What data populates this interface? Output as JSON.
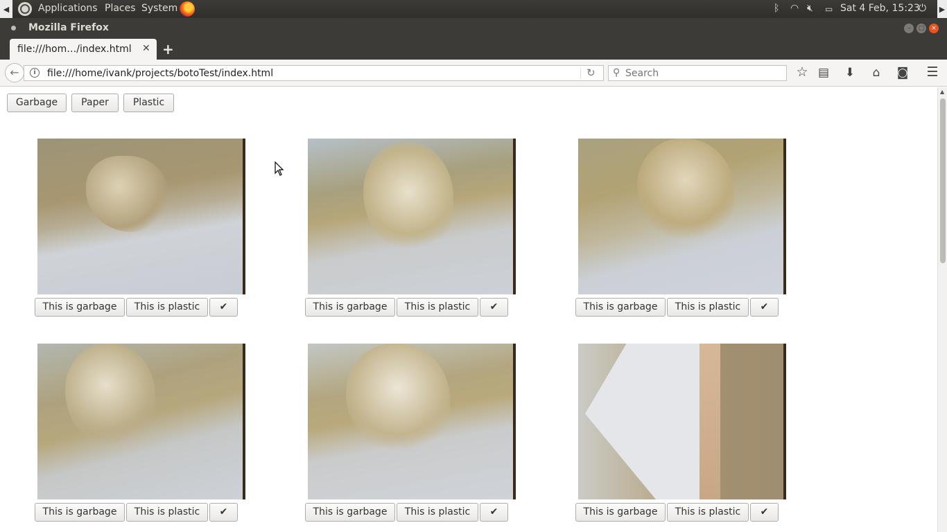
{
  "system_panel": {
    "menus": [
      "Applications",
      "Places",
      "System"
    ],
    "datetime": "Sat  4 Feb, 15:23"
  },
  "window": {
    "title": "Mozilla Firefox"
  },
  "tab": {
    "label": "file:///hom…/index.html"
  },
  "navbar": {
    "url": "file:///home/ivank/projects/botoTest/index.html",
    "search_placeholder": "Search"
  },
  "category_buttons": [
    "Garbage",
    "Paper",
    "Plastic"
  ],
  "item_buttons": {
    "garbage": "This is garbage",
    "plastic": "This is plastic",
    "confirm": "✔"
  },
  "icons": {
    "back": "back-arrow-icon",
    "info": "info-icon",
    "reload": "reload-icon",
    "search": "search-icon",
    "bookmark": "star-icon",
    "reading_list": "clipboard-icon",
    "downloads": "download-icon",
    "home": "home-icon",
    "pocket": "pocket-icon",
    "menu": "hamburger-menu-icon"
  },
  "colors": {
    "panel_bg": "#3c3b37",
    "close_button": "#e95420"
  }
}
